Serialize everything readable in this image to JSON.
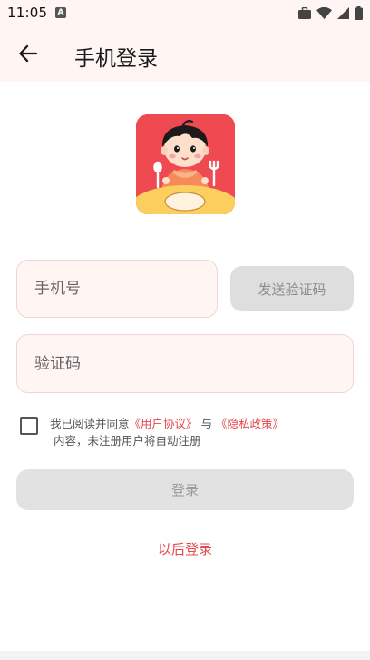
{
  "status_bar": {
    "time": "11:05",
    "notification_letter": "A",
    "icons": [
      "briefcase-icon",
      "wifi-icon",
      "cellular-signal-icon",
      "battery-icon"
    ]
  },
  "app_bar": {
    "back_icon": "arrow-left-icon",
    "title": "手机登录"
  },
  "logo": {
    "icon": "child-at-dinner-table-icon",
    "colors": {
      "background": "#ef4952",
      "table": "#fbcf5e",
      "shirt": "#f58a5a"
    }
  },
  "form": {
    "phone_placeholder": "手机号",
    "send_code_label": "发送验证码",
    "code_placeholder": "验证码"
  },
  "agreement": {
    "checked": false,
    "prefix": "我已阅读并同意",
    "user_agreement": "《用户协议》",
    "conjunction": " 与 ",
    "privacy_policy": "《隐私政策》",
    "suffix": "内容，未注册用户将自动注册"
  },
  "login_button": "登录",
  "later_link": "以后登录",
  "colors": {
    "accent": "#e5474c",
    "header_bg": "#fff5f2",
    "disabled_button": "#e2e2e2"
  }
}
